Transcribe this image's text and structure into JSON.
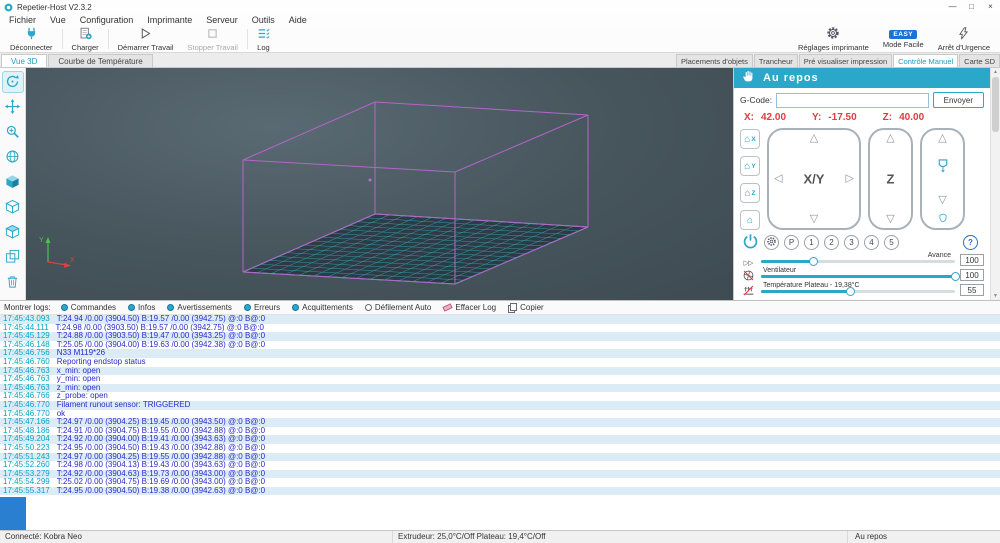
{
  "window": {
    "title": "Repetier-Host V2.3.2",
    "minimize": "—",
    "maximize": "□",
    "close": "×"
  },
  "menu": {
    "items": [
      "Fichier",
      "Vue",
      "Configuration",
      "Imprimante",
      "Serveur",
      "Outils",
      "Aide"
    ]
  },
  "toolbar": {
    "left": [
      {
        "label": "Déconnecter",
        "icon": "plug-icon"
      },
      {
        "label": "Charger",
        "icon": "load-file-icon"
      },
      {
        "label": "Démarrer Travail",
        "icon": "play-icon"
      },
      {
        "label": "Stopper Travail",
        "icon": "stop-icon",
        "disabled": true
      },
      {
        "label": "Log",
        "icon": "log-icon"
      }
    ],
    "right": [
      {
        "label": "Réglages imprimante",
        "icon": "gear-icon"
      },
      {
        "label": "Mode Facile",
        "icon": "easy-badge",
        "badge": "EASY"
      },
      {
        "label": "Arrêt d'Urgence",
        "icon": "lightning-icon"
      }
    ]
  },
  "view_tabs": [
    {
      "label": "Vue 3D"
    },
    {
      "label": "Courbe de Température"
    }
  ],
  "right_tabs": [
    "Placements d'objets",
    "Trancheur",
    "Pré visualiser impression",
    "Contrôle Manuel",
    "Carte SD"
  ],
  "view_toolbar": {
    "icons": [
      "rotate-view",
      "move-viewport",
      "zoom-view",
      "fit-view",
      "isometric-view",
      "front-view",
      "top-view",
      "parallel-projection",
      "delete-object"
    ]
  },
  "control": {
    "status_header": "Au repos",
    "gcode_label": "G-Code:",
    "gcode_value": "",
    "send_button": "Envoyer",
    "position": {
      "x_label": "X:",
      "x": "42.00",
      "y_label": "Y:",
      "y": "-17.50",
      "z_label": "Z:",
      "z": "40.00"
    },
    "xy_pad_label": "X/Y",
    "z_pad_label": "Z",
    "preset_buttons": [
      "P",
      "1",
      "2",
      "3",
      "4",
      "5",
      "?"
    ],
    "feedrate": {
      "label": "Avance",
      "value": "100"
    },
    "fan": {
      "label": "Ventilateur",
      "value": "100"
    },
    "bed": {
      "label": "Température Plateau - 19,38°C",
      "value": "55"
    }
  },
  "colors": {
    "accent": "#2ba7c9",
    "alert": "#e23b3b",
    "easy_blue": "#1a73d4",
    "log_time": "#00a3c6",
    "log_text": "#2929cc",
    "bed_grid": "#3aa6ba",
    "box_wire": "#b565c9"
  },
  "log": {
    "toolbar": {
      "label": "Montrer logs:",
      "filters": [
        "Commandes",
        "Infos",
        "Avertissements",
        "Erreurs",
        "Acquittements"
      ],
      "autoscroll": "Défilement Auto",
      "clear": "Effacer Log",
      "copy": "Copier"
    },
    "lines": [
      {
        "time": "17:45:43.093",
        "text": "T:24.94 /0.00 (3904.50) B:19.57 /0.00 (3942.75) @:0 B@:0"
      },
      {
        "time": "17:45:44.111",
        "text": "T:24.98 /0.00 (3903.50) B:19.57 /0.00 (3942.75) @:0 B@:0"
      },
      {
        "time": "17:45:45.129",
        "text": "T:24.88 /0.00 (3903.50) B:19.47 /0.00 (3943.25) @:0 B@:0"
      },
      {
        "time": "17:45:46.148",
        "text": "T:25.05 /0.00 (3904.00) B:19.63 /0.00 (3942.38) @:0 B@:0"
      },
      {
        "time": "17:45:46.756",
        "text": "N33 M119*26"
      },
      {
        "time": "17:45:46.760",
        "text": "Reporting endstop status"
      },
      {
        "time": "17:45:46.763",
        "text": "x_min: open"
      },
      {
        "time": "17:45:46.763",
        "text": "y_min: open"
      },
      {
        "time": "17:45:46.763",
        "text": "z_min: open"
      },
      {
        "time": "17:45:46.766",
        "text": "z_probe: open"
      },
      {
        "time": "17:45:46.770",
        "text": "Filament runout sensor: TRIGGERED"
      },
      {
        "time": "17:45:46.770",
        "text": "ok"
      },
      {
        "time": "17:45:47.166",
        "text": "T:24.97 /0.00 (3904.25) B:19.45 /0.00 (3943.50) @:0 B@:0"
      },
      {
        "time": "17:45:48.186",
        "text": "T:24.91 /0.00 (3904.75) B:19.55 /0.00 (3942.88) @:0 B@:0"
      },
      {
        "time": "17:45:49.204",
        "text": "T:24.92 /0.00 (3904.00) B:19.41 /0.00 (3943.63) @:0 B@:0"
      },
      {
        "time": "17:45:50.223",
        "text": "T:24.95 /0.00 (3904.50) B:19.43 /0.00 (3942.88) @:0 B@:0"
      },
      {
        "time": "17:45:51.243",
        "text": "T:24.97 /0.00 (3904.25) B:19.55 /0.00 (3942.88) @:0 B@:0"
      },
      {
        "time": "17:45:52.260",
        "text": "T:24.98 /0.00 (3904.13) B:19.43 /0.00 (3943.63) @:0 B@:0"
      },
      {
        "time": "17:45:53.279",
        "text": "T:24.92 /0.00 (3904.63) B:19.73 /0.00 (3943.00) @:0 B@:0"
      },
      {
        "time": "17:45:54.299",
        "text": "T:25.02 /0.00 (3904.75) B:19.69 /0.00 (3943.00) @:0 B@:0"
      },
      {
        "time": "17:45:55.317",
        "text": "T:24.95 /0.00 (3904.50) B:19.38 /0.00 (3942.63) @:0 B@:0"
      }
    ]
  },
  "statusbar": {
    "left": "Connecté: Kobra Neo",
    "center": "Extrudeur: 25,0°C/Off  Plateau: 19,4°C/Off",
    "right": "Au repos"
  }
}
